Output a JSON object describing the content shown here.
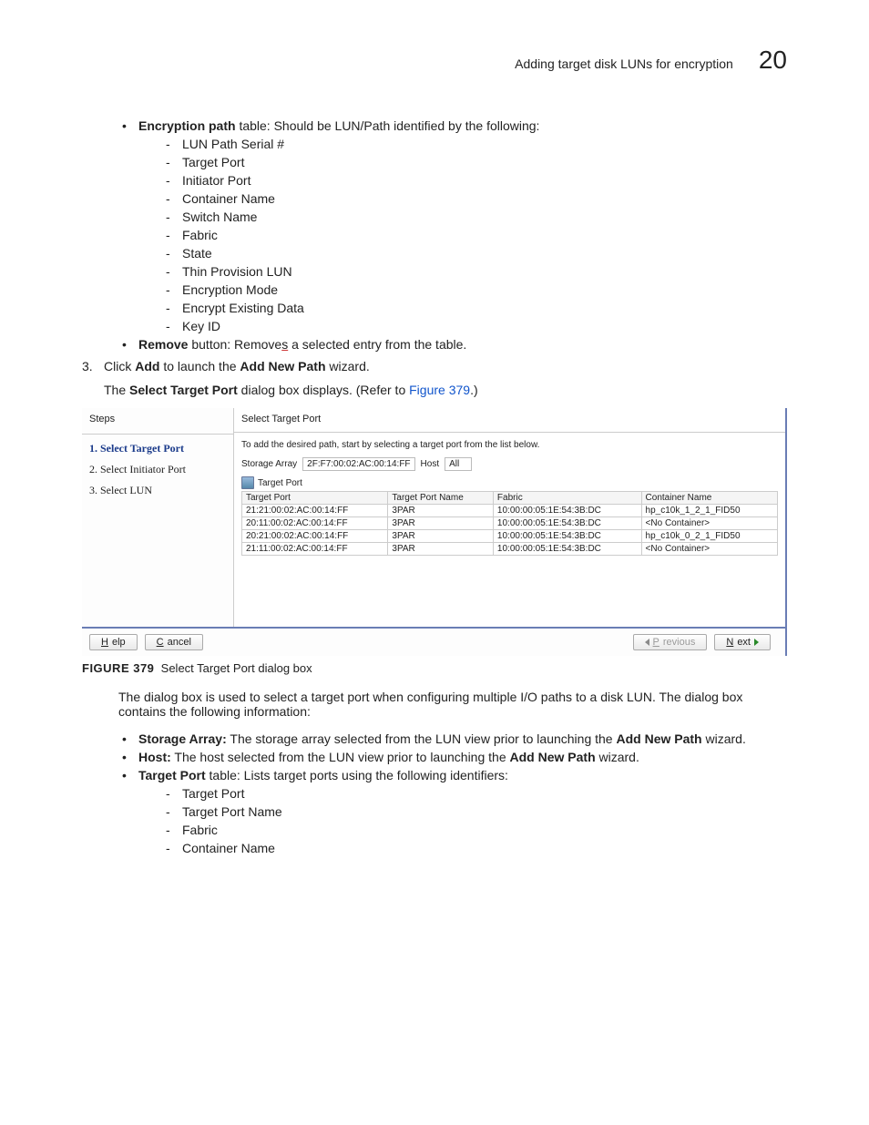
{
  "header": {
    "title": "Adding target disk LUNs for encryption",
    "number": "20"
  },
  "section1": {
    "bullet1_prefix_bold": "Encryption path",
    "bullet1_rest": " table: Should be LUN/Path identified by the following:",
    "sublist1": [
      "LUN Path Serial #",
      "Target Port",
      "Initiator Port",
      "Container Name",
      "Switch Name",
      "Fabric",
      "State",
      "Thin Provision LUN",
      "Encryption Mode",
      "Encrypt Existing Data",
      "Key ID"
    ],
    "bullet2_prefix_bold": "Remove",
    "bullet2_mid": " button: Remove",
    "bullet2_typo": "s",
    "bullet2_end": " a selected entry from the table."
  },
  "step3": {
    "num": "3.",
    "t1": "Click ",
    "b1": "Add",
    "t2": " to launch the ",
    "b2": "Add New Path",
    "t3": " wizard.",
    "p2a": "The ",
    "p2b": "Select Target Port",
    "p2c": " dialog box displays. (Refer to ",
    "p2link": "Figure 379",
    "p2d": ".)"
  },
  "dialog": {
    "steps_title": "Steps",
    "steps": [
      "1. Select Target Port",
      "2. Select Initiator Port",
      "3. Select LUN"
    ],
    "main_title": "Select Target Port",
    "instruction": "To add the desired path, start by selecting a target port from the list below.",
    "storage_label": "Storage Array",
    "storage_value": "2F:F7:00:02:AC:00:14:FF",
    "host_label": "Host",
    "host_value": "All",
    "tp_label": "Target Port",
    "columns": [
      "Target Port",
      "Target Port Name",
      "Fabric",
      "Container Name"
    ],
    "rows": [
      [
        "21:21:00:02:AC:00:14:FF",
        "3PAR",
        "10:00:00:05:1E:54:3B:DC",
        "hp_c10k_1_2_1_FID50"
      ],
      [
        "20:11:00:02:AC:00:14:FF",
        "3PAR",
        "10:00:00:05:1E:54:3B:DC",
        "<No Container>"
      ],
      [
        "20:21:00:02:AC:00:14:FF",
        "3PAR",
        "10:00:00:05:1E:54:3B:DC",
        "hp_c10k_0_2_1_FID50"
      ],
      [
        "21:11:00:02:AC:00:14:FF",
        "3PAR",
        "10:00:00:05:1E:54:3B:DC",
        "<No Container>"
      ]
    ],
    "btn_help": "elp",
    "btn_help_u": "H",
    "btn_cancel": "ancel",
    "btn_cancel_u": "C",
    "btn_prev": "revious",
    "btn_prev_u": "P",
    "btn_next": "ext",
    "btn_next_u": "N"
  },
  "figure": {
    "label": "FIGURE 379",
    "caption": "Select Target Port dialog box"
  },
  "after": {
    "p1": "The dialog box is used to select a target port when configuring multiple I/O paths to a disk LUN. The dialog box contains the following information:",
    "b1_bold": "Storage Array:",
    "b1_mid": " The storage array selected from the LUN view prior to launching the ",
    "b1_bold2": "Add New Path",
    "b1_end": " wizard.",
    "b2_bold": "Host:",
    "b2_mid": " The host selected from the LUN view prior to launching the ",
    "b2_bold2": "Add New Path",
    "b2_end": " wizard.",
    "b3_bold": "Target Port",
    "b3_rest": " table: Lists target ports using the following identifiers:",
    "sublist": [
      "Target Port",
      "Target Port Name",
      "Fabric",
      "Container Name"
    ]
  }
}
